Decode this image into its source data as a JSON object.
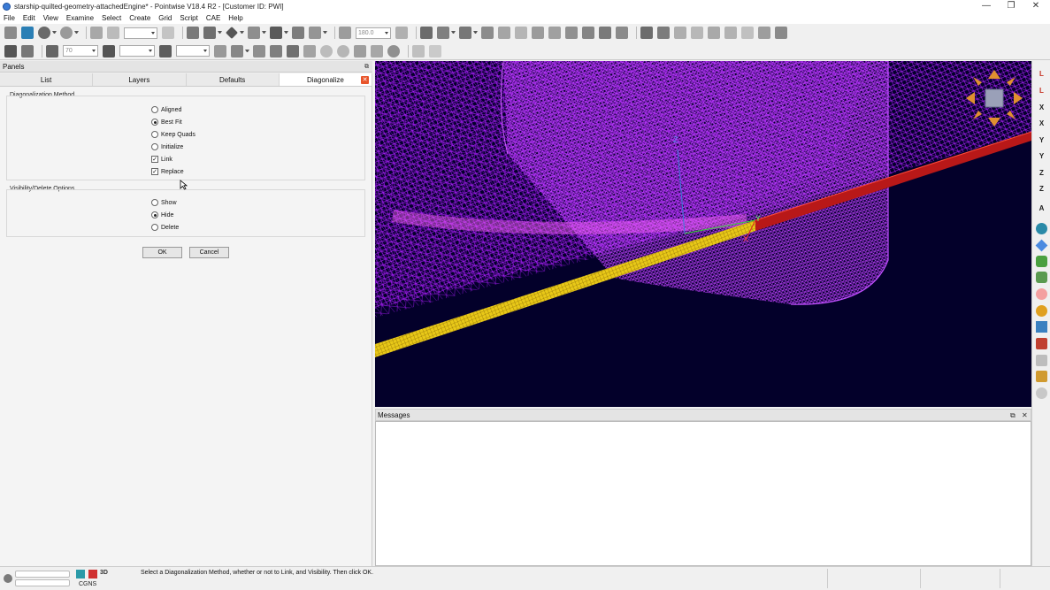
{
  "window": {
    "title": "starship-quilted-geometry-attachedEngine* - Pointwise V18.4 R2 - [Customer ID: PWI]",
    "minimize": "—",
    "restore": "❐",
    "close": "✕"
  },
  "menu": [
    "File",
    "Edit",
    "View",
    "Examine",
    "Select",
    "Create",
    "Grid",
    "Script",
    "CAE",
    "Help"
  ],
  "toolbar": {
    "angle_value": "180.0",
    "density_value": "70"
  },
  "panels": {
    "title": "Panels",
    "float_icon": "⧉",
    "tabs": [
      "List",
      "Layers",
      "Defaults",
      "Diagonalize"
    ],
    "active_tab": "Diagonalize",
    "tab_close": "✕"
  },
  "diag": {
    "method_label": "Diagonalization Method",
    "methods": [
      {
        "label": "Aligned",
        "selected": false
      },
      {
        "label": "Best Fit",
        "selected": true
      },
      {
        "label": "Keep Quads",
        "selected": false
      },
      {
        "label": "Initialize",
        "selected": false
      }
    ],
    "link_label": "Link",
    "link_checked": true,
    "replace_label": "Replace",
    "replace_checked": true,
    "visibility_label": "Visibility/Delete Options",
    "visibility": [
      {
        "label": "Show",
        "selected": false
      },
      {
        "label": "Hide",
        "selected": true
      },
      {
        "label": "Delete",
        "selected": false
      }
    ],
    "ok_label": "OK",
    "cancel_label": "Cancel",
    "check_mark": "✓"
  },
  "viewport": {
    "axis_z": "Z",
    "axis_y": "Y",
    "axis_x": "X",
    "background": "#03002a",
    "mesh_color": "#b020ff",
    "plate_color": "#f0d020",
    "edge_color": "#d02020"
  },
  "rightbar": [
    "L",
    "L",
    "X",
    "X",
    "Y",
    "Y",
    "Z",
    "Z",
    "A"
  ],
  "messages": {
    "title": "Messages",
    "float_icon": "⧉",
    "close_icon": "✕"
  },
  "status": {
    "solver": "CGNS",
    "mode3d": "3D",
    "message": "Select a Diagonalization Method, whether or not to Link, and Visibility. Then click OK."
  }
}
